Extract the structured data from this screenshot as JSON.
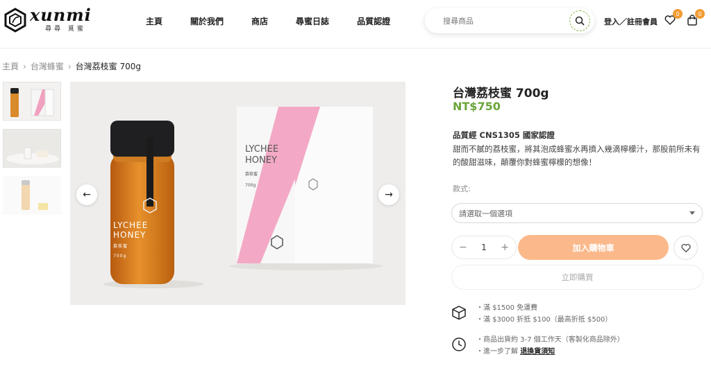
{
  "header": {
    "logo_word": "xunmi",
    "logo_sub": "尋尋 覓蜜",
    "nav": [
      "主頁",
      "關於我們",
      "商店",
      "尋蜜日誌",
      "品質認證"
    ],
    "search_placeholder": "搜尋商品",
    "login_label": "登入／註冊會員",
    "wishlist_count": "0",
    "cart_count": "0"
  },
  "breadcrumb": {
    "items": [
      "主頁",
      "台灣蜂蜜"
    ],
    "current": "台灣荔枝蜜 700g"
  },
  "gallery": {
    "main_box_text": "LYCHEE HONEY",
    "main_box_sub": "荔枝蜜",
    "main_box_weight": "700g",
    "bottle_text": "LYCHEE HONEY",
    "bottle_sub": "荔枝蜜",
    "bottle_weight": "700g",
    "prev_icon": "arrow-left-icon",
    "next_icon": "arrow-right-icon"
  },
  "product": {
    "title": "台灣荔枝蜜 700g",
    "price": "NT$750",
    "cert": "品質經 CNS1305 國家認證",
    "description": "甜而不膩的荔枝蜜，將其泡成蜂蜜水再擠入幾滴檸檬汁，那股前所未有的酸甜滋味，顛覆你對蜂蜜檸檬的想像！",
    "option_label": "款式:",
    "option_placeholder": "請選取一個選項",
    "quantity": "1",
    "add_to_cart": "加入購物車",
    "buy_now": "立即購買"
  },
  "shipping": {
    "line1": "・滿 $1500 免運費",
    "line2": "・滿 $3000 折抵 $100（最高折抵 $500）"
  },
  "delivery": {
    "line1": "・商品出貨約 3-7 個工作天（客製化商品除外）",
    "line2_prefix": "・進一步了解 ",
    "line2_link": "退換貨須知"
  },
  "colors": {
    "price_green": "#6aa53a",
    "cart_orange": "#fbb98b",
    "badge_orange": "#f39c33",
    "box_pink": "#f1a1bf"
  }
}
